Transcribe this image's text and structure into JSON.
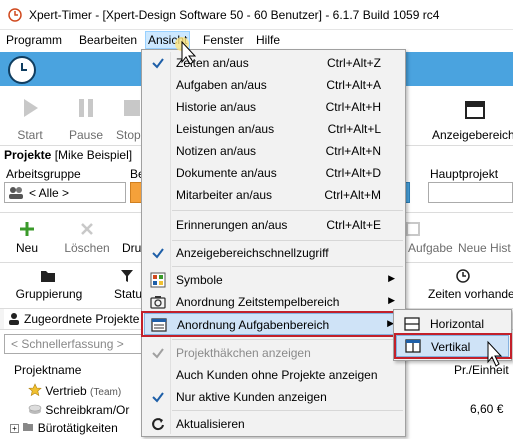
{
  "window": {
    "title": "Xpert-Timer - [Xpert-Design Software 50 - 60 Benutzer] - 6.1.7 Build 1059 rc4"
  },
  "menubar": {
    "items": [
      "Programm",
      "Bearbeiten",
      "Ansicht",
      "Fenster",
      "Hilfe"
    ],
    "active": "Ansicht"
  },
  "toolbar": {
    "start": "Start",
    "pause": "Pause",
    "stop": "Stopp",
    "anzeigebereich": "Anzeigebereich"
  },
  "projects": {
    "header": "Projekte",
    "user": "[Mike Beispiel]",
    "arbeitsgruppe_label": "Arbeitsgruppe",
    "arbeitsgruppe_value": "< Alle >",
    "be_label": "Be",
    "hauptprojekt_label": "Hauptprojekt"
  },
  "actions": {
    "neu": "Neu",
    "loeschen": "Löschen",
    "dru": "Dru",
    "aufgabe": "Aufgabe",
    "neue_hist": "Neue Hist"
  },
  "actions2": {
    "gruppierung": "Gruppierung",
    "status": "Statu",
    "zeiten": "Zeiten vorhande"
  },
  "tabs": {
    "zugeordnete": "Zugeordnete Projekte"
  },
  "filter": {
    "placeholder": "< Schnellerfassung >"
  },
  "tree": {
    "col_name": "Projektname",
    "col_price": "Pr./Einheit",
    "rows": [
      {
        "name": "Vertrieb",
        "tag": "(Team)",
        "price": ""
      },
      {
        "name": "Schreibkram/Or",
        "tag": "",
        "price": "6,60 €"
      },
      {
        "name": "Bürotätigkeiten",
        "tag": "",
        "price": ""
      }
    ]
  },
  "view_menu": {
    "items": [
      {
        "label": "Zeiten an/aus",
        "shortcut": "Ctrl+Alt+Z",
        "checked": true
      },
      {
        "label": "Aufgaben an/aus",
        "shortcut": "Ctrl+Alt+A"
      },
      {
        "label": "Historie an/aus",
        "shortcut": "Ctrl+Alt+H"
      },
      {
        "label": "Leistungen an/aus",
        "shortcut": "Ctrl+Alt+L"
      },
      {
        "label": "Notizen an/aus",
        "shortcut": "Ctrl+Alt+N"
      },
      {
        "label": "Dokumente an/aus",
        "shortcut": "Ctrl+Alt+D"
      },
      {
        "label": "Mitarbeiter an/aus",
        "shortcut": "Ctrl+Alt+M"
      },
      {
        "label": "Erinnerungen an/aus",
        "shortcut": "Ctrl+Alt+E"
      },
      {
        "label": "Anzeigebereichschnellzugriff",
        "checked": true
      },
      {
        "label": "Symbole",
        "submenu": true
      },
      {
        "label": "Anordnung Zeitstempelbereich",
        "submenu": true
      },
      {
        "label": "Anordnung Aufgabenbereich",
        "submenu": true
      },
      {
        "label": "Projekthäkchen anzeigen",
        "disabled": true,
        "checked": true
      },
      {
        "label": "Auch Kunden ohne Projekte anzeigen"
      },
      {
        "label": "Nur aktive Kunden anzeigen",
        "checked": true
      },
      {
        "label": "Aktualisieren"
      }
    ]
  },
  "submenu": {
    "horizontal": "Horizontal",
    "vertikal": "Vertikal"
  },
  "colors": {
    "accent_blue": "#4aa3df",
    "highlight": "#cfe3f7",
    "callout_red": "#c2202a"
  }
}
